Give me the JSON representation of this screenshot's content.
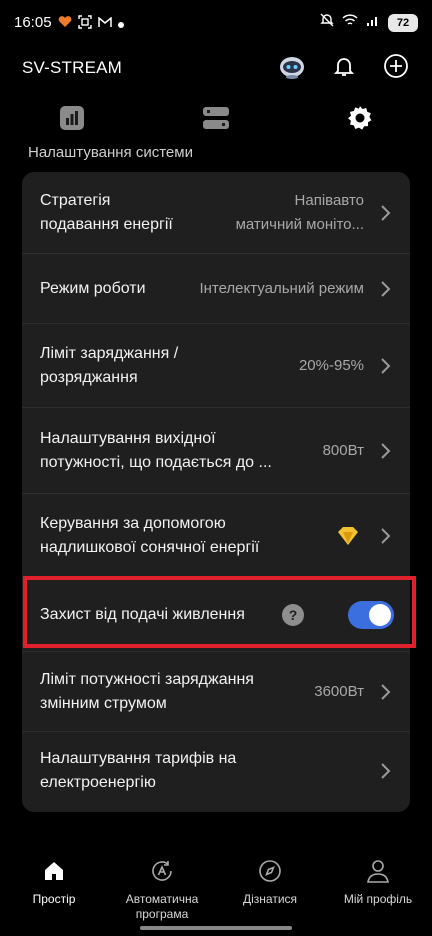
{
  "status_bar": {
    "time": "16:05",
    "battery": "72"
  },
  "header": {
    "title": "SV-STREAM"
  },
  "section_label": "Налаштування системи",
  "settings": {
    "strategy": {
      "label_1": "Стратегія",
      "label_2": "подавання енергії",
      "value_1": "Напівавто",
      "value_2": "матичний моніто..."
    },
    "mode": {
      "label": "Режим роботи",
      "value": "Інтелектуальний режим"
    },
    "charge_limit": {
      "label_1": "Ліміт заряджання /",
      "label_2": "розряджання",
      "value": "20%-95%"
    },
    "output_power": {
      "label_1": "Налаштування вихідної",
      "label_2": "потужності, що подається до ...",
      "value": "800Вт"
    },
    "solar_control": {
      "label_1": "Керування за допомогою",
      "label_2": "надлишкової сонячної енергії"
    },
    "power_protection": {
      "label": "Захист від подачі живлення",
      "help": "?",
      "enabled": true
    },
    "ac_charge_limit": {
      "label_1": "Ліміт потужності заряджання",
      "label_2": "змінним струмом",
      "value": "3600Вт"
    },
    "tariff": {
      "label_1": "Налаштування тарифів на",
      "label_2": "електроенергію"
    }
  },
  "bottom_nav": {
    "home": "Простір",
    "auto_1": "Автоматична",
    "auto_2": "програма",
    "discover": "Дізнатися",
    "profile": "Мій профіль"
  },
  "colors": {
    "accent": "#3b6fe0",
    "highlight": "#e0202b",
    "card": "#1f1f1f",
    "premium": "#f2c230"
  }
}
